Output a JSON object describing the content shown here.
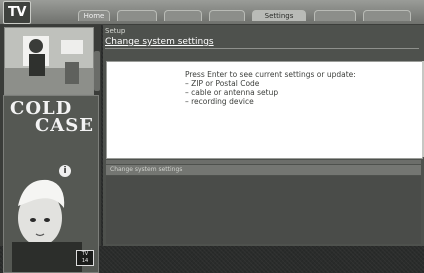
{
  "app": {
    "logo": "TV"
  },
  "tabs": [
    {
      "label": "Home",
      "active": false
    },
    {
      "label": "",
      "active": false
    },
    {
      "label": "",
      "active": false
    },
    {
      "label": "",
      "active": false
    },
    {
      "label": "Settings",
      "active": true
    },
    {
      "label": "",
      "active": false
    },
    {
      "label": "",
      "active": false
    }
  ],
  "sidebar": {
    "poster_title_line1": "COLD",
    "poster_title_line2": "CASE",
    "info_badge": "i",
    "rating_badge_line1": "TV",
    "rating_badge_line2": "14",
    "colors": {
      "poster_bg": "#555853"
    }
  },
  "breadcrumb": "Setup",
  "page_title": "Change system settings",
  "panel": {
    "intro": "Press Enter to see current settings or update:",
    "items": [
      "– ZIP or Postal Code",
      "– cable or antenna setup",
      "– recording device"
    ]
  },
  "status": "Change system settings"
}
